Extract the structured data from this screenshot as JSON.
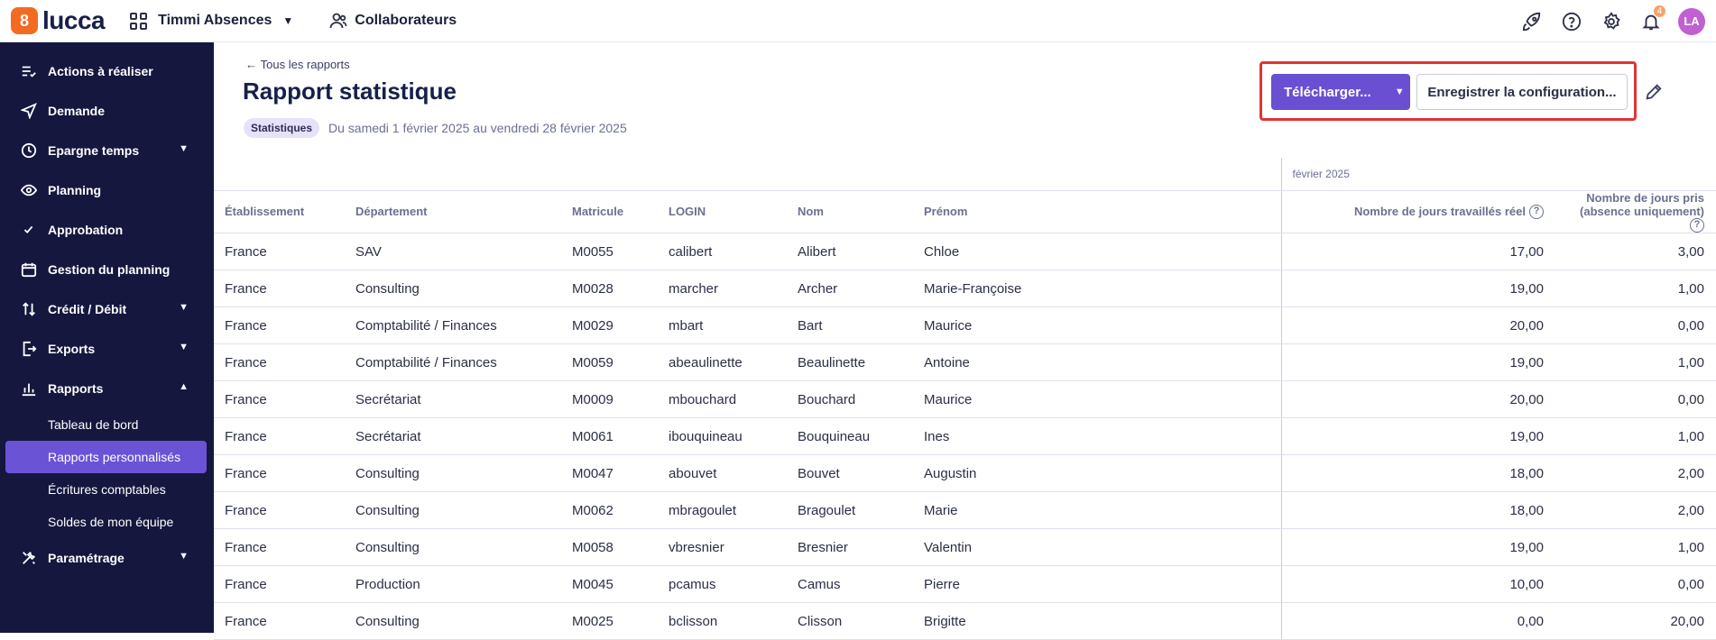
{
  "topbar": {
    "logo_text": "lucca",
    "app_name": "Timmi Absences",
    "collaborators_label": "Collaborateurs",
    "notifications_count": "4",
    "avatar_initials": "LA"
  },
  "sidebar": {
    "items": [
      {
        "label": "Actions à réaliser",
        "icon": "tasks-icon"
      },
      {
        "label": "Demande",
        "icon": "send-icon"
      },
      {
        "label": "Epargne temps",
        "icon": "clock-icon",
        "expandable": true
      },
      {
        "label": "Planning",
        "icon": "eye-icon"
      },
      {
        "label": "Approbation",
        "icon": "check-icon"
      },
      {
        "label": "Gestion du planning",
        "icon": "calendar-icon"
      },
      {
        "label": "Crédit / Débit",
        "icon": "swap-icon",
        "expandable": true
      },
      {
        "label": "Exports",
        "icon": "export-icon",
        "expandable": true
      },
      {
        "label": "Rapports",
        "icon": "chart-icon",
        "expanded": true
      }
    ],
    "subitems": [
      {
        "label": "Tableau de bord"
      },
      {
        "label": "Rapports personnalisés",
        "active": true
      },
      {
        "label": "Écritures comptables"
      },
      {
        "label": "Soldes de mon équipe"
      }
    ],
    "settings_label": "Paramétrage"
  },
  "header": {
    "back_label": "Tous les rapports",
    "title": "Rapport statistique",
    "tag": "Statistiques",
    "period": "Du samedi 1 février 2025 au vendredi 28 février 2025"
  },
  "actions": {
    "download_label": "Télécharger...",
    "save_label": "Enregistrer la configuration..."
  },
  "table": {
    "group_label": "février 2025",
    "columns": [
      "Établissement",
      "Département",
      "Matricule",
      "LOGIN",
      "Nom",
      "Prénom",
      "Nombre de jours travaillés réel",
      "Nombre de jours pris (absence uniquement)"
    ],
    "rows": [
      [
        "France",
        "SAV",
        "M0055",
        "calibert",
        "Alibert",
        "Chloe",
        "17,00",
        "3,00"
      ],
      [
        "France",
        "Consulting",
        "M0028",
        "marcher",
        "Archer",
        "Marie-Françoise",
        "19,00",
        "1,00"
      ],
      [
        "France",
        "Comptabilité / Finances",
        "M0029",
        "mbart",
        "Bart",
        "Maurice",
        "20,00",
        "0,00"
      ],
      [
        "France",
        "Comptabilité / Finances",
        "M0059",
        "abeaulinette",
        "Beaulinette",
        "Antoine",
        "19,00",
        "1,00"
      ],
      [
        "France",
        "Secrétariat",
        "M0009",
        "mbouchard",
        "Bouchard",
        "Maurice",
        "20,00",
        "0,00"
      ],
      [
        "France",
        "Secrétariat",
        "M0061",
        "ibouquineau",
        "Bouquineau",
        "Ines",
        "19,00",
        "1,00"
      ],
      [
        "France",
        "Consulting",
        "M0047",
        "abouvet",
        "Bouvet",
        "Augustin",
        "18,00",
        "2,00"
      ],
      [
        "France",
        "Consulting",
        "M0062",
        "mbragoulet",
        "Bragoulet",
        "Marie",
        "18,00",
        "2,00"
      ],
      [
        "France",
        "Consulting",
        "M0058",
        "vbresnier",
        "Bresnier",
        "Valentin",
        "19,00",
        "1,00"
      ],
      [
        "France",
        "Production",
        "M0045",
        "pcamus",
        "Camus",
        "Pierre",
        "10,00",
        "0,00"
      ],
      [
        "France",
        "Consulting",
        "M0025",
        "bclisson",
        "Clisson",
        "Brigitte",
        "0,00",
        "20,00"
      ]
    ]
  }
}
